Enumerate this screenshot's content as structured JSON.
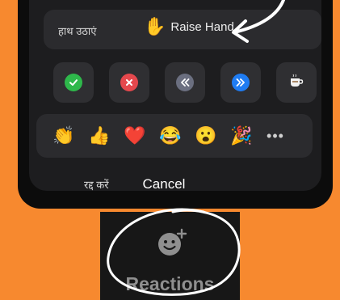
{
  "raise_hand": {
    "hindi_label": "हाथ उठाएं",
    "emoji": "✋",
    "label": "Raise Hand"
  },
  "feedback_buttons": [
    {
      "name": "yes",
      "icon": "check-icon",
      "color": "#2eb84b"
    },
    {
      "name": "no",
      "icon": "x-icon",
      "color": "#e5484d"
    },
    {
      "name": "go-slower",
      "icon": "rewind-icon",
      "color": "#6b6f80"
    },
    {
      "name": "go-faster",
      "icon": "fast-forward-icon",
      "color": "#1f7cf2"
    },
    {
      "name": "coffee",
      "icon": "coffee-icon",
      "color": "#e0e0e0"
    }
  ],
  "emoji_reactions": [
    {
      "name": "clapping",
      "emoji": "👏"
    },
    {
      "name": "thumbs-up",
      "emoji": "👍"
    },
    {
      "name": "heart",
      "emoji": "❤️"
    },
    {
      "name": "joy",
      "emoji": "😂"
    },
    {
      "name": "surprised",
      "emoji": "😮"
    },
    {
      "name": "party",
      "emoji": "🎉"
    }
  ],
  "more_label": "•••",
  "cancel": {
    "hindi_label": "रद्द करें",
    "label": "Cancel"
  },
  "reactions_button": {
    "label": "Reactions",
    "icon": "smiley-plus-icon"
  }
}
